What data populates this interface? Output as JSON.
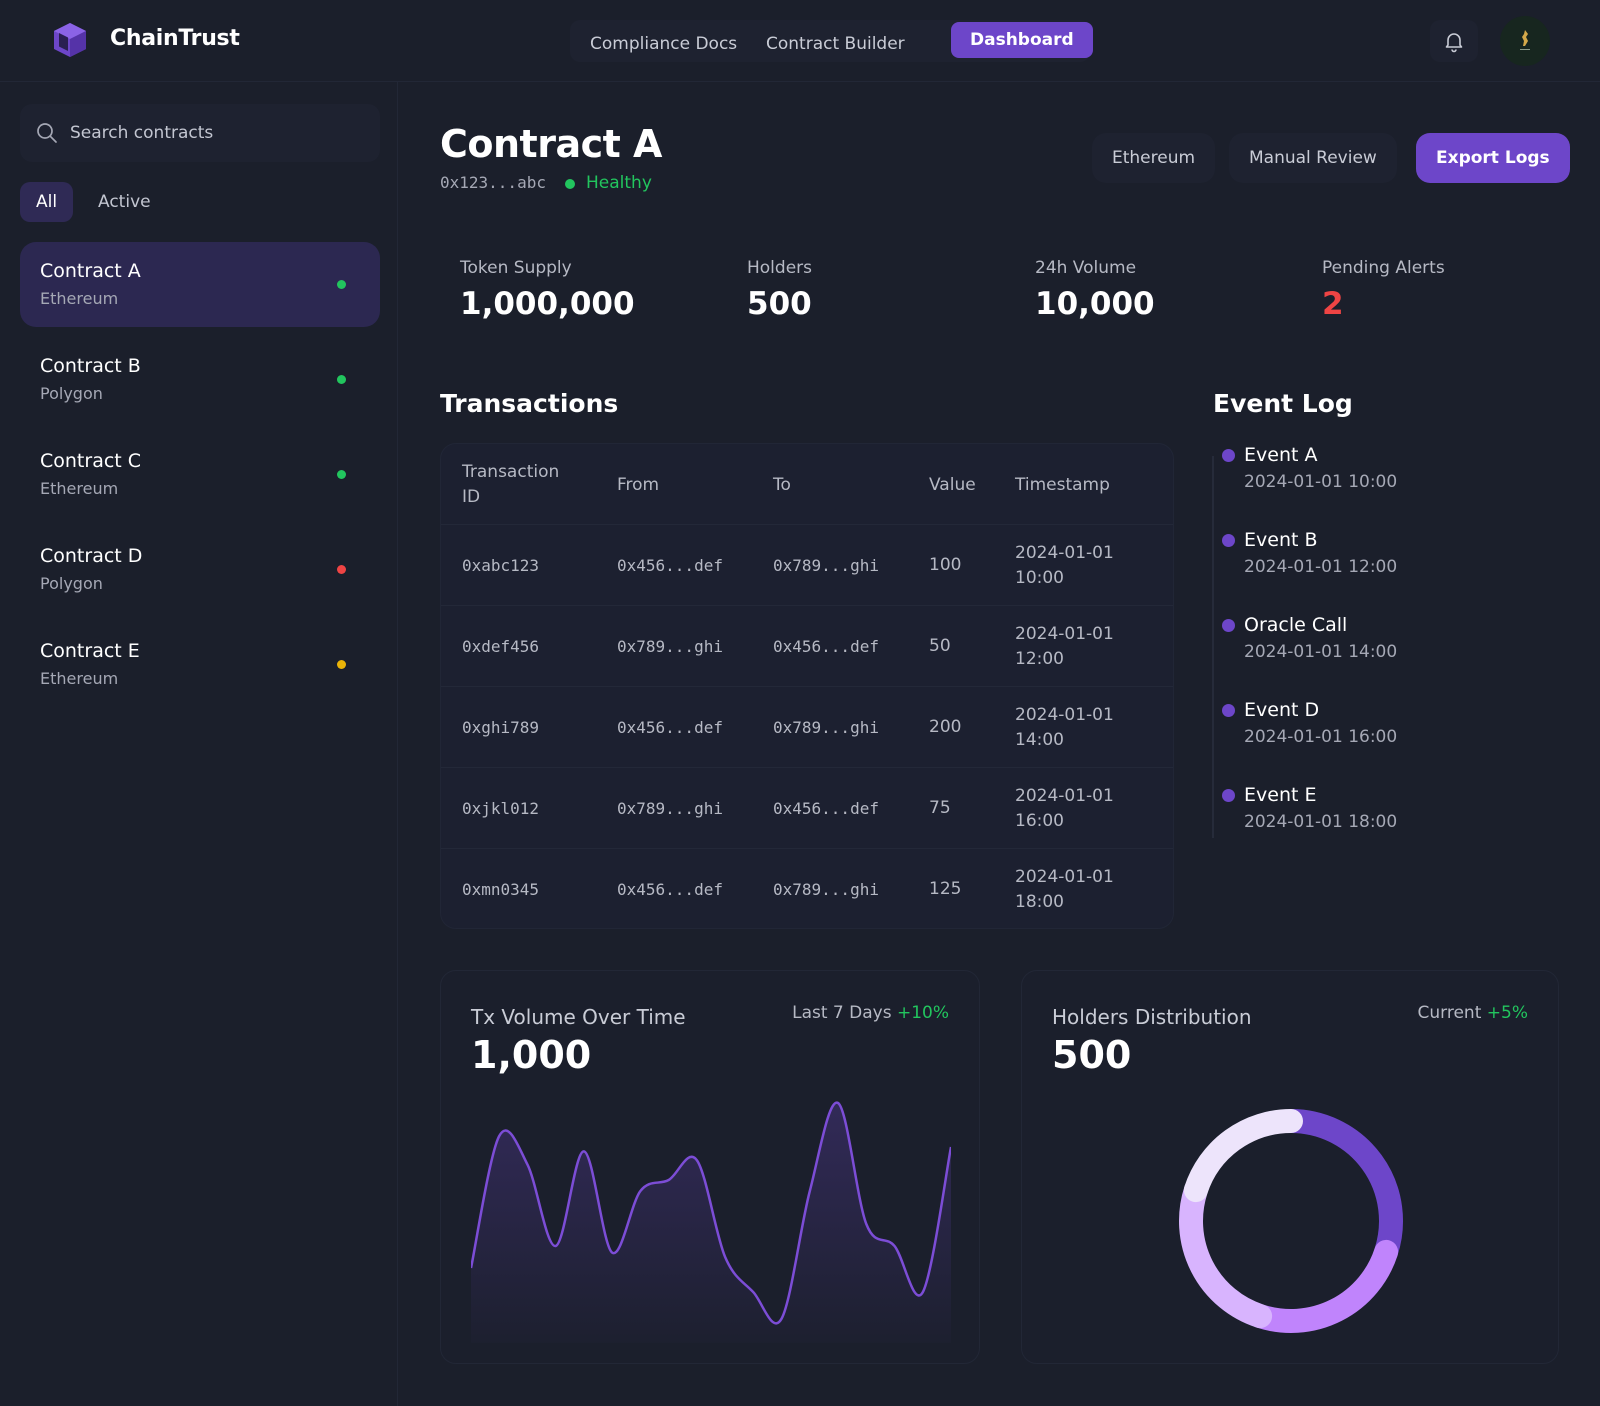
{
  "app": {
    "brand": "ChainTrust"
  },
  "nav": {
    "items": [
      {
        "label": "Compliance Docs"
      },
      {
        "label": "Contract Builder"
      },
      {
        "label": "Dashboard"
      }
    ],
    "active": "Dashboard"
  },
  "sidebar": {
    "search_placeholder": "Search contracts",
    "filters": [
      "All",
      "Active"
    ],
    "active_filter": "All",
    "contracts": [
      {
        "name": "Contract A",
        "chain": "Ethereum",
        "status_color": "#22c55e"
      },
      {
        "name": "Contract B",
        "chain": "Polygon",
        "status_color": "#22c55e"
      },
      {
        "name": "Contract C",
        "chain": "Ethereum",
        "status_color": "#22c55e"
      },
      {
        "name": "Contract D",
        "chain": "Polygon",
        "status_color": "#ef4444"
      },
      {
        "name": "Contract E",
        "chain": "Ethereum",
        "status_color": "#eab308"
      }
    ]
  },
  "contract": {
    "title": "Contract A",
    "address": "0x123...abc",
    "health": "Healthy",
    "buttons": {
      "network": "Ethereum",
      "review": "Manual Review",
      "export": "Export Logs"
    }
  },
  "stats": [
    {
      "label": "Token Supply",
      "value": "1,000,000"
    },
    {
      "label": "Holders",
      "value": "500"
    },
    {
      "label": "24h Volume",
      "value": "10,000"
    },
    {
      "label": "Pending Alerts",
      "value": "2"
    }
  ],
  "transactions": {
    "title": "Transactions",
    "headers": {
      "id": "Transaction ID",
      "from": "From",
      "to": "To",
      "value": "Value",
      "timestamp": "Timestamp"
    },
    "rows": [
      {
        "id": "0xabc123",
        "from": "0x456...def",
        "to": "0x789...ghi",
        "value": "100",
        "date": "2024-01-01",
        "time": "10:00"
      },
      {
        "id": "0xdef456",
        "from": "0x789...ghi",
        "to": "0x456...def",
        "value": "50",
        "date": "2024-01-01",
        "time": "12:00"
      },
      {
        "id": "0xghi789",
        "from": "0x456...def",
        "to": "0x789...ghi",
        "value": "200",
        "date": "2024-01-01",
        "time": "14:00"
      },
      {
        "id": "0xjkl012",
        "from": "0x789...ghi",
        "to": "0x456...def",
        "value": "75",
        "date": "2024-01-01",
        "time": "16:00"
      },
      {
        "id": "0xmn0345",
        "from": "0x456...def",
        "to": "0x789...ghi",
        "value": "125",
        "date": "2024-01-01",
        "time": "18:00"
      }
    ]
  },
  "event_log": {
    "title": "Event Log",
    "events": [
      {
        "name": "Event A",
        "time": "2024-01-01 10:00"
      },
      {
        "name": "Event B",
        "time": "2024-01-01 12:00"
      },
      {
        "name": "Oracle Call",
        "time": "2024-01-01 14:00"
      },
      {
        "name": "Event D",
        "time": "2024-01-01 16:00"
      },
      {
        "name": "Event E",
        "time": "2024-01-01 18:00"
      }
    ]
  },
  "cards": {
    "volume": {
      "title": "Tx Volume Over Time",
      "value": "1,000",
      "period": "Last 7 Days",
      "delta": "+10%"
    },
    "holders": {
      "title": "Holders Distribution",
      "value": "500",
      "period": "Current",
      "delta": "+5%"
    }
  },
  "colors": {
    "accent": "#6d46c9",
    "healthy": "#22c55e",
    "alert": "#ef4444",
    "warning": "#eab308"
  },
  "chart_data": [
    {
      "type": "area",
      "title": "Tx Volume Over Time",
      "xlabel": "",
      "ylabel": "",
      "x": [
        0,
        1,
        2,
        3,
        4,
        5,
        6,
        7,
        8,
        9,
        10,
        11,
        12,
        13,
        14,
        15,
        16,
        17,
        18,
        19,
        20,
        21,
        22,
        23,
        24,
        25,
        26
      ],
      "values": [
        0.25,
        0.85,
        0.72,
        0.35,
        0.78,
        0.32,
        0.6,
        0.65,
        0.74,
        0.3,
        0.14,
        0.02,
        0.6,
        1.0,
        0.45,
        0.35,
        0.14,
        0.8
      ],
      "ylim": [
        0,
        1
      ],
      "grid": false,
      "color": "#7c4dd6"
    },
    {
      "type": "pie",
      "title": "Holders Distribution",
      "values": [
        30,
        25,
        25,
        20
      ],
      "colors": [
        "#6d46c9",
        "#c084fc",
        "#d8b4fe",
        "#ede4fb"
      ]
    }
  ]
}
